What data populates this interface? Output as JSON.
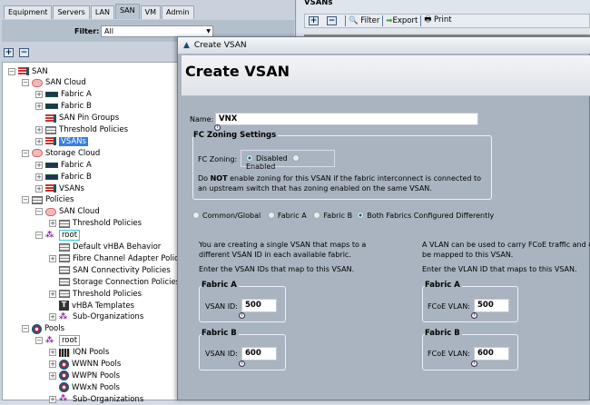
{
  "left": {
    "tabs": [
      "Equipment",
      "Servers",
      "LAN",
      "SAN",
      "VM",
      "Admin"
    ],
    "active_tab": "SAN",
    "filter_label": "Filter:",
    "filter_value": "All",
    "tree": [
      {
        "label": "SAN",
        "level": 0,
        "exp": "-",
        "icon": "san"
      },
      {
        "label": "SAN Cloud",
        "level": 1,
        "exp": "-",
        "icon": "cloud"
      },
      {
        "label": "Fabric A",
        "level": 2,
        "exp": "+",
        "icon": "fab"
      },
      {
        "label": "Fabric B",
        "level": 2,
        "exp": "+",
        "icon": "fab"
      },
      {
        "label": "SAN Pin Groups",
        "level": 2,
        "exp": "",
        "icon": "san"
      },
      {
        "label": "Threshold Policies",
        "level": 2,
        "exp": "+",
        "icon": "pol"
      },
      {
        "label": "VSANs",
        "level": 2,
        "exp": "+",
        "icon": "san",
        "selected": true
      },
      {
        "label": "Storage Cloud",
        "level": 1,
        "exp": "-",
        "icon": "cloud"
      },
      {
        "label": "Fabric A",
        "level": 2,
        "exp": "+",
        "icon": "fab"
      },
      {
        "label": "Fabric B",
        "level": 2,
        "exp": "+",
        "icon": "fab"
      },
      {
        "label": "VSANs",
        "level": 2,
        "exp": "+",
        "icon": "san"
      },
      {
        "label": "Policies",
        "level": 1,
        "exp": "-",
        "icon": "pol"
      },
      {
        "label": "SAN Cloud",
        "level": 2,
        "exp": "-",
        "icon": "cloud"
      },
      {
        "label": "Threshold Policies",
        "level": 3,
        "exp": "+",
        "icon": "pol"
      },
      {
        "label": "root",
        "level": 2,
        "exp": "-",
        "icon": "org",
        "boxed": true
      },
      {
        "label": "Default vHBA Behavior",
        "level": 3,
        "exp": "",
        "icon": "pol"
      },
      {
        "label": "Fibre Channel Adapter Policies",
        "level": 3,
        "exp": "+",
        "icon": "pol"
      },
      {
        "label": "SAN Connectivity Policies",
        "level": 3,
        "exp": "",
        "icon": "pol"
      },
      {
        "label": "Storage Connection Policies",
        "level": 3,
        "exp": "",
        "icon": "pol"
      },
      {
        "label": "Threshold Policies",
        "level": 3,
        "exp": "+",
        "icon": "pol"
      },
      {
        "label": "vHBA Templates",
        "level": 3,
        "exp": "",
        "icon": "tpl"
      },
      {
        "label": "Sub-Organizations",
        "level": 3,
        "exp": "+",
        "icon": "org"
      },
      {
        "label": "Pools",
        "level": 1,
        "exp": "-",
        "icon": "pool"
      },
      {
        "label": "root",
        "level": 2,
        "exp": "-",
        "icon": "org",
        "boxed": true
      },
      {
        "label": "IQN Pools",
        "level": 3,
        "exp": "+",
        "icon": "iqn"
      },
      {
        "label": "WWNN Pools",
        "level": 3,
        "exp": "+",
        "icon": "pool"
      },
      {
        "label": "WWPN Pools",
        "level": 3,
        "exp": "+",
        "icon": "pool"
      },
      {
        "label": "WWxN Pools",
        "level": 3,
        "exp": "",
        "icon": "pool"
      },
      {
        "label": "Sub-Organizations",
        "level": 3,
        "exp": "+",
        "icon": "org"
      }
    ]
  },
  "right": {
    "title": "VSANs",
    "filter": "Filter",
    "export": "Export",
    "print": "Print"
  },
  "dialog": {
    "window_title": "Create VSAN",
    "heading": "Create VSAN",
    "name_label": "Name:",
    "name_value": "VNX",
    "fc_zoning": {
      "legend": "FC Zoning Settings",
      "label": "FC Zoning:",
      "options": [
        "Disabled",
        "Enabled"
      ],
      "selected": "Disabled",
      "warn_pre": "Do ",
      "warn_bold": "NOT",
      "warn_post": " enable zoning for this VSAN if the fabric interconnect is connected to an upstream switch that has zoning enabled on the same VSAN."
    },
    "scope_options": [
      "Common/Global",
      "Fabric A",
      "Fabric B",
      "Both Fabrics Configured Differently"
    ],
    "scope_selected": "Both Fabrics Configured Differently",
    "left_desc": "You are creating a single VSAN that maps to a different VSAN ID in each available fabric.",
    "left_enter": "Enter the VSAN IDs that map to this VSAN.",
    "right_desc": "A VLAN can be used to carry FCoE traffic and can be mapped to this VSAN.",
    "right_enter": "Enter the VLAN ID that maps to this VSAN.",
    "fabric_a": {
      "legend": "Fabric A",
      "vsan_label": "VSAN ID:",
      "vsan_id": "500",
      "vlan_label": "FCoE VLAN:",
      "vlan_id": "500"
    },
    "fabric_b": {
      "legend": "Fabric B",
      "vsan_label": "VSAN ID:",
      "vsan_id": "600",
      "vlan_label": "FCoE VLAN:",
      "vlan_id": "600"
    }
  }
}
